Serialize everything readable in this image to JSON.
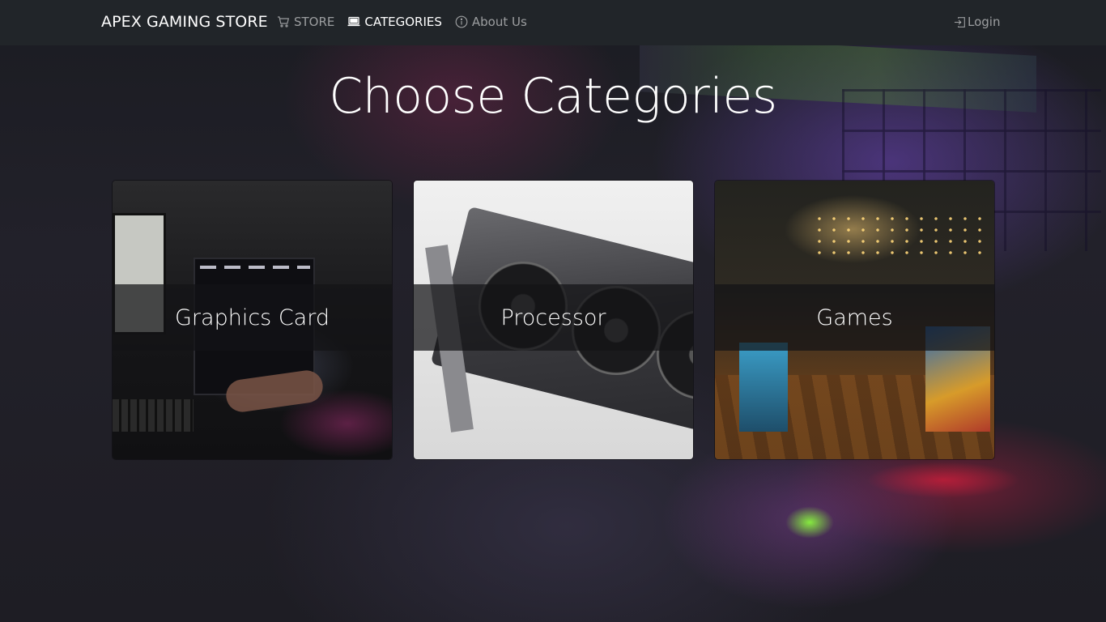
{
  "navbar": {
    "brand": "APEX GAMING STORE",
    "links": [
      {
        "label": "STORE",
        "icon": "cart-icon",
        "active": false
      },
      {
        "label": "CATEGORIES",
        "icon": "laptop-icon",
        "active": true
      },
      {
        "label": "About Us",
        "icon": "info-circle-icon",
        "active": false
      }
    ],
    "login_label": "Login",
    "login_icon": "login-icon"
  },
  "main": {
    "title": "Choose Categories",
    "categories": [
      {
        "label": "Graphics Card"
      },
      {
        "label": "Processor"
      },
      {
        "label": "Games"
      }
    ]
  },
  "colors": {
    "navbar_bg": "#212529",
    "nav_active": "#ffffff",
    "nav_inactive": "rgba(255,255,255,0.55)"
  }
}
